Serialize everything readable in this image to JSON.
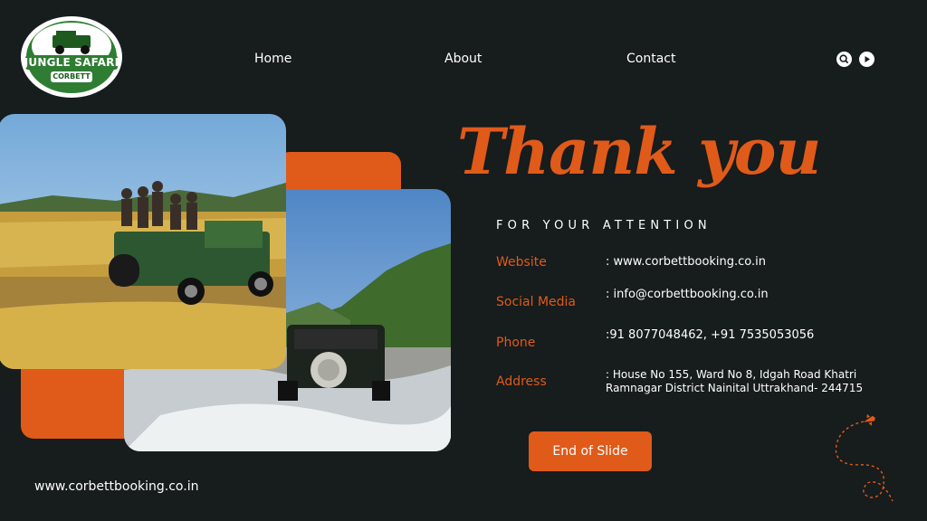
{
  "brand": {
    "logo_line1": "JUNGLE SAFARI",
    "logo_line2": "CORBETT"
  },
  "nav": {
    "items": [
      "Home",
      "About",
      "Contact"
    ]
  },
  "header_icons": [
    "search-icon",
    "play-icon"
  ],
  "hero": {
    "title": "Thank you",
    "subtitle": "FOR YOUR ATTENTION"
  },
  "contact": {
    "website_label": "Website",
    "website_value": ": www.corbettbooking.co.in",
    "social_label": "Social Media",
    "social_value": ": info@corbettbooking.co.in",
    "phone_label": "Phone",
    "phone_value": ":91 8077048462, +91 7535053056",
    "address_label": "Address",
    "address_line1": ": House No 155, Ward No 8, Idgah Road Khatri",
    "address_line2": "Ramnagar District Nainital Uttrakhand- 244715"
  },
  "cta": {
    "label": "End of Slide"
  },
  "footer": {
    "url": "www.corbettbooking.co.in"
  },
  "colors": {
    "accent": "#e05a1a",
    "background": "#171c1c",
    "logo_green": "#2e7d32"
  }
}
